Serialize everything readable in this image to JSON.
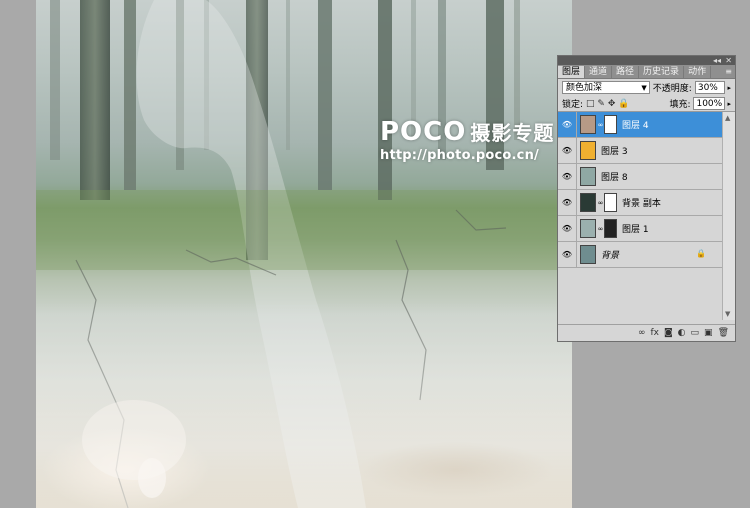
{
  "watermark": {
    "logo_text": "POCO",
    "logo_subtitle": "摄影专题",
    "url": "http://photo.poco.cn/"
  },
  "panel": {
    "title_controls": {
      "collapse": "◂◂",
      "close": "✕"
    },
    "tabs": [
      {
        "label": "图层",
        "active": true
      },
      {
        "label": "通道",
        "active": false
      },
      {
        "label": "路径",
        "active": false
      },
      {
        "label": "历史记录",
        "active": false
      },
      {
        "label": "动作",
        "active": false
      }
    ],
    "menu_icon": "≡",
    "blend_mode": "颜色加深",
    "opacity_label": "不透明度:",
    "opacity_value": "30%",
    "lock_label": "锁定:",
    "lock_icons": "□ ✎ ✥ 🔒",
    "fill_label": "填充:",
    "fill_value": "100%",
    "layers": [
      {
        "name": "图层 4",
        "selected": true,
        "thumb": "#b79a86",
        "mask": "#ffffff",
        "italic": false
      },
      {
        "name": "图层 3",
        "selected": false,
        "thumb": "#f0b030",
        "mask": "",
        "italic": false
      },
      {
        "name": "图层 8",
        "selected": false,
        "thumb": "#8fa8a4",
        "mask": "",
        "italic": false
      },
      {
        "name": "背景 副本",
        "selected": false,
        "thumb": "#2a3a35",
        "mask": "#ffffff",
        "italic": false
      },
      {
        "name": "图层 1",
        "selected": false,
        "thumb": "#9bb0ae",
        "mask": "#222222",
        "italic": false
      },
      {
        "name": "背景",
        "selected": false,
        "thumb": "#6f8d8f",
        "mask": "",
        "italic": true
      }
    ],
    "bottom_icons": [
      "∞",
      "fx",
      "◙",
      "◐",
      "▭",
      "▣",
      "🗑"
    ]
  }
}
